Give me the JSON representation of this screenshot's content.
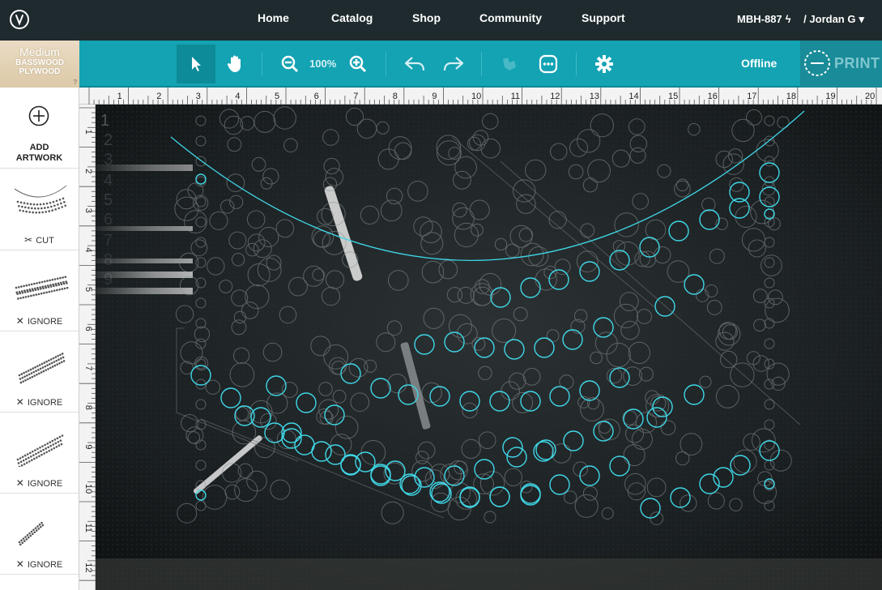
{
  "nav": {
    "links": [
      "Home",
      "Catalog",
      "Shop",
      "Community",
      "Support"
    ],
    "device": "MBH-887",
    "user": "/ Jordan G"
  },
  "material": {
    "thickness": "Medium",
    "name": "BASSWOOD PLYWOOD",
    "help": "?"
  },
  "toolbar": {
    "zoom": "100%",
    "status": "Offline",
    "print_label": "PRINT",
    "icons": [
      "select-arrow-icon",
      "hand-pan-icon",
      "zoom-out-icon",
      "zoom-in-icon",
      "undo-icon",
      "redo-icon",
      "magic-wand-icon",
      "more-icon",
      "gear-icon",
      "print-circle-icon"
    ]
  },
  "sidebar": {
    "add_artwork": "ADD\nARTWORK",
    "items": [
      {
        "status": "CUT",
        "icon": "scissors-icon"
      },
      {
        "status": "IGNORE",
        "icon": "x-icon"
      },
      {
        "status": "IGNORE",
        "icon": "x-icon"
      },
      {
        "status": "IGNORE",
        "icon": "x-icon"
      },
      {
        "status": "IGNORE",
        "icon": "x-icon"
      }
    ]
  },
  "rulers": {
    "top": [
      "1",
      "2",
      "3",
      "4",
      "5",
      "6",
      "7",
      "8",
      "9",
      "10",
      "11",
      "12",
      "13",
      "14",
      "15",
      "16",
      "17",
      "18",
      "19",
      "20"
    ],
    "left": [
      "1",
      "2",
      "3",
      "4",
      "5",
      "6",
      "7",
      "8",
      "9",
      "10",
      "11",
      "12"
    ]
  },
  "colors": {
    "nav_bg": "#1e2a2e",
    "toolbar": "#13a3b3",
    "accent_cyan": "#3fd6e6",
    "canvas": "#15191b"
  }
}
